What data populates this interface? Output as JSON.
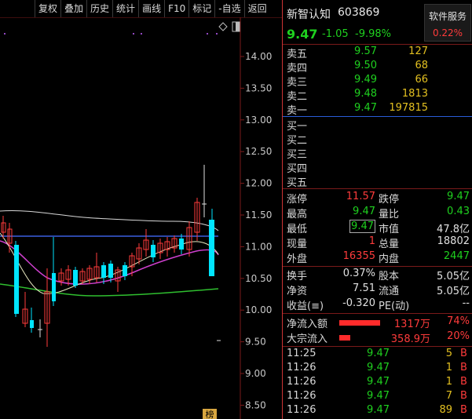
{
  "toolbar": [
    "复权",
    "叠加",
    "历史",
    "统计",
    "画线",
    "F10",
    "标记",
    "-自选",
    "返回"
  ],
  "chart": {
    "y_ticks": [
      "14.00",
      "13.50",
      "13.00",
      "12.50",
      "12.00",
      "11.50",
      "11.00",
      "10.50",
      "10.00",
      "9.50",
      "9.00",
      "8.50"
    ],
    "badge": "榜",
    "tick_values": [
      14.0,
      13.5,
      13.0,
      12.5,
      12.0,
      11.5,
      11.0,
      10.5,
      10.0,
      9.5,
      9.0,
      8.5
    ]
  },
  "stock": {
    "name": "新智认知",
    "code": "603869",
    "price": "9.47",
    "change": "-1.05",
    "change_pct": "-9.98%",
    "service_label": "软件服务",
    "service_pct": "0.22%"
  },
  "orderbook": {
    "sells": [
      {
        "label": "卖五",
        "price": "9.57",
        "vol": "127"
      },
      {
        "label": "卖四",
        "price": "9.50",
        "vol": "68"
      },
      {
        "label": "卖三",
        "price": "9.49",
        "vol": "66"
      },
      {
        "label": "卖二",
        "price": "9.48",
        "vol": "1813"
      },
      {
        "label": "卖一",
        "price": "9.47",
        "vol": "197815"
      }
    ],
    "buys": [
      {
        "label": "买一"
      },
      {
        "label": "买二"
      },
      {
        "label": "买三"
      },
      {
        "label": "买四"
      },
      {
        "label": "买五"
      }
    ]
  },
  "stats": [
    {
      "l1": "涨停",
      "v1": "11.57",
      "c1": "red",
      "l2": "跌停",
      "v2": "9.47",
      "c2": "green"
    },
    {
      "l1": "最高",
      "v1": "9.47",
      "c1": "green",
      "l2": "量比",
      "v2": "0.43",
      "c2": "green"
    },
    {
      "l1": "最低",
      "v1": "9.47",
      "c1": "green",
      "l2": "市值",
      "v2": "47.8亿",
      "c2": "white",
      "box1": true
    },
    {
      "l1": "现量",
      "v1": "1",
      "c1": "red",
      "l2": "总量",
      "v2": "18802",
      "c2": "white"
    },
    {
      "l1": "外盘",
      "v1": "16355",
      "c1": "red",
      "l2": "内盘",
      "v2": "2447",
      "c2": "green"
    },
    {
      "l1": "换手",
      "v1": "0.37%",
      "c1": "white",
      "l2": "股本",
      "v2": "5.05亿",
      "c2": "white"
    },
    {
      "l1": "净资",
      "v1": "7.51",
      "c1": "white",
      "l2": "流通",
      "v2": "5.05亿",
      "c2": "white"
    },
    {
      "l1": "收益(≡)",
      "v1": "-0.320",
      "c1": "white",
      "l2": "PE(动)",
      "v2": "--",
      "c2": "white"
    }
  ],
  "flows": [
    {
      "label": "净流入额",
      "value": "1317万",
      "pct": "74%",
      "bar_fraction": 0.74
    },
    {
      "label": "大宗流入",
      "value": "358.9万",
      "pct": "20%",
      "bar_fraction": 0.2
    }
  ],
  "ticks": [
    {
      "time": "11:25",
      "price": "9.47",
      "vol": "5",
      "dir": "B"
    },
    {
      "time": "11:26",
      "price": "9.47",
      "vol": "1",
      "dir": "B"
    },
    {
      "time": "11:26",
      "price": "9.47",
      "vol": "1",
      "dir": "B"
    },
    {
      "time": "11:26",
      "price": "9.47",
      "vol": "7",
      "dir": "B"
    },
    {
      "time": "11:26",
      "price": "9.47",
      "vol": "89",
      "dir": "B"
    }
  ],
  "colors": {
    "up": "#ff3b3b",
    "down": "#1fd11f",
    "volume": "#e3c020",
    "bg": "#000000"
  },
  "icons": [
    "diamond-icon",
    "panel-toggle-icon"
  ]
}
